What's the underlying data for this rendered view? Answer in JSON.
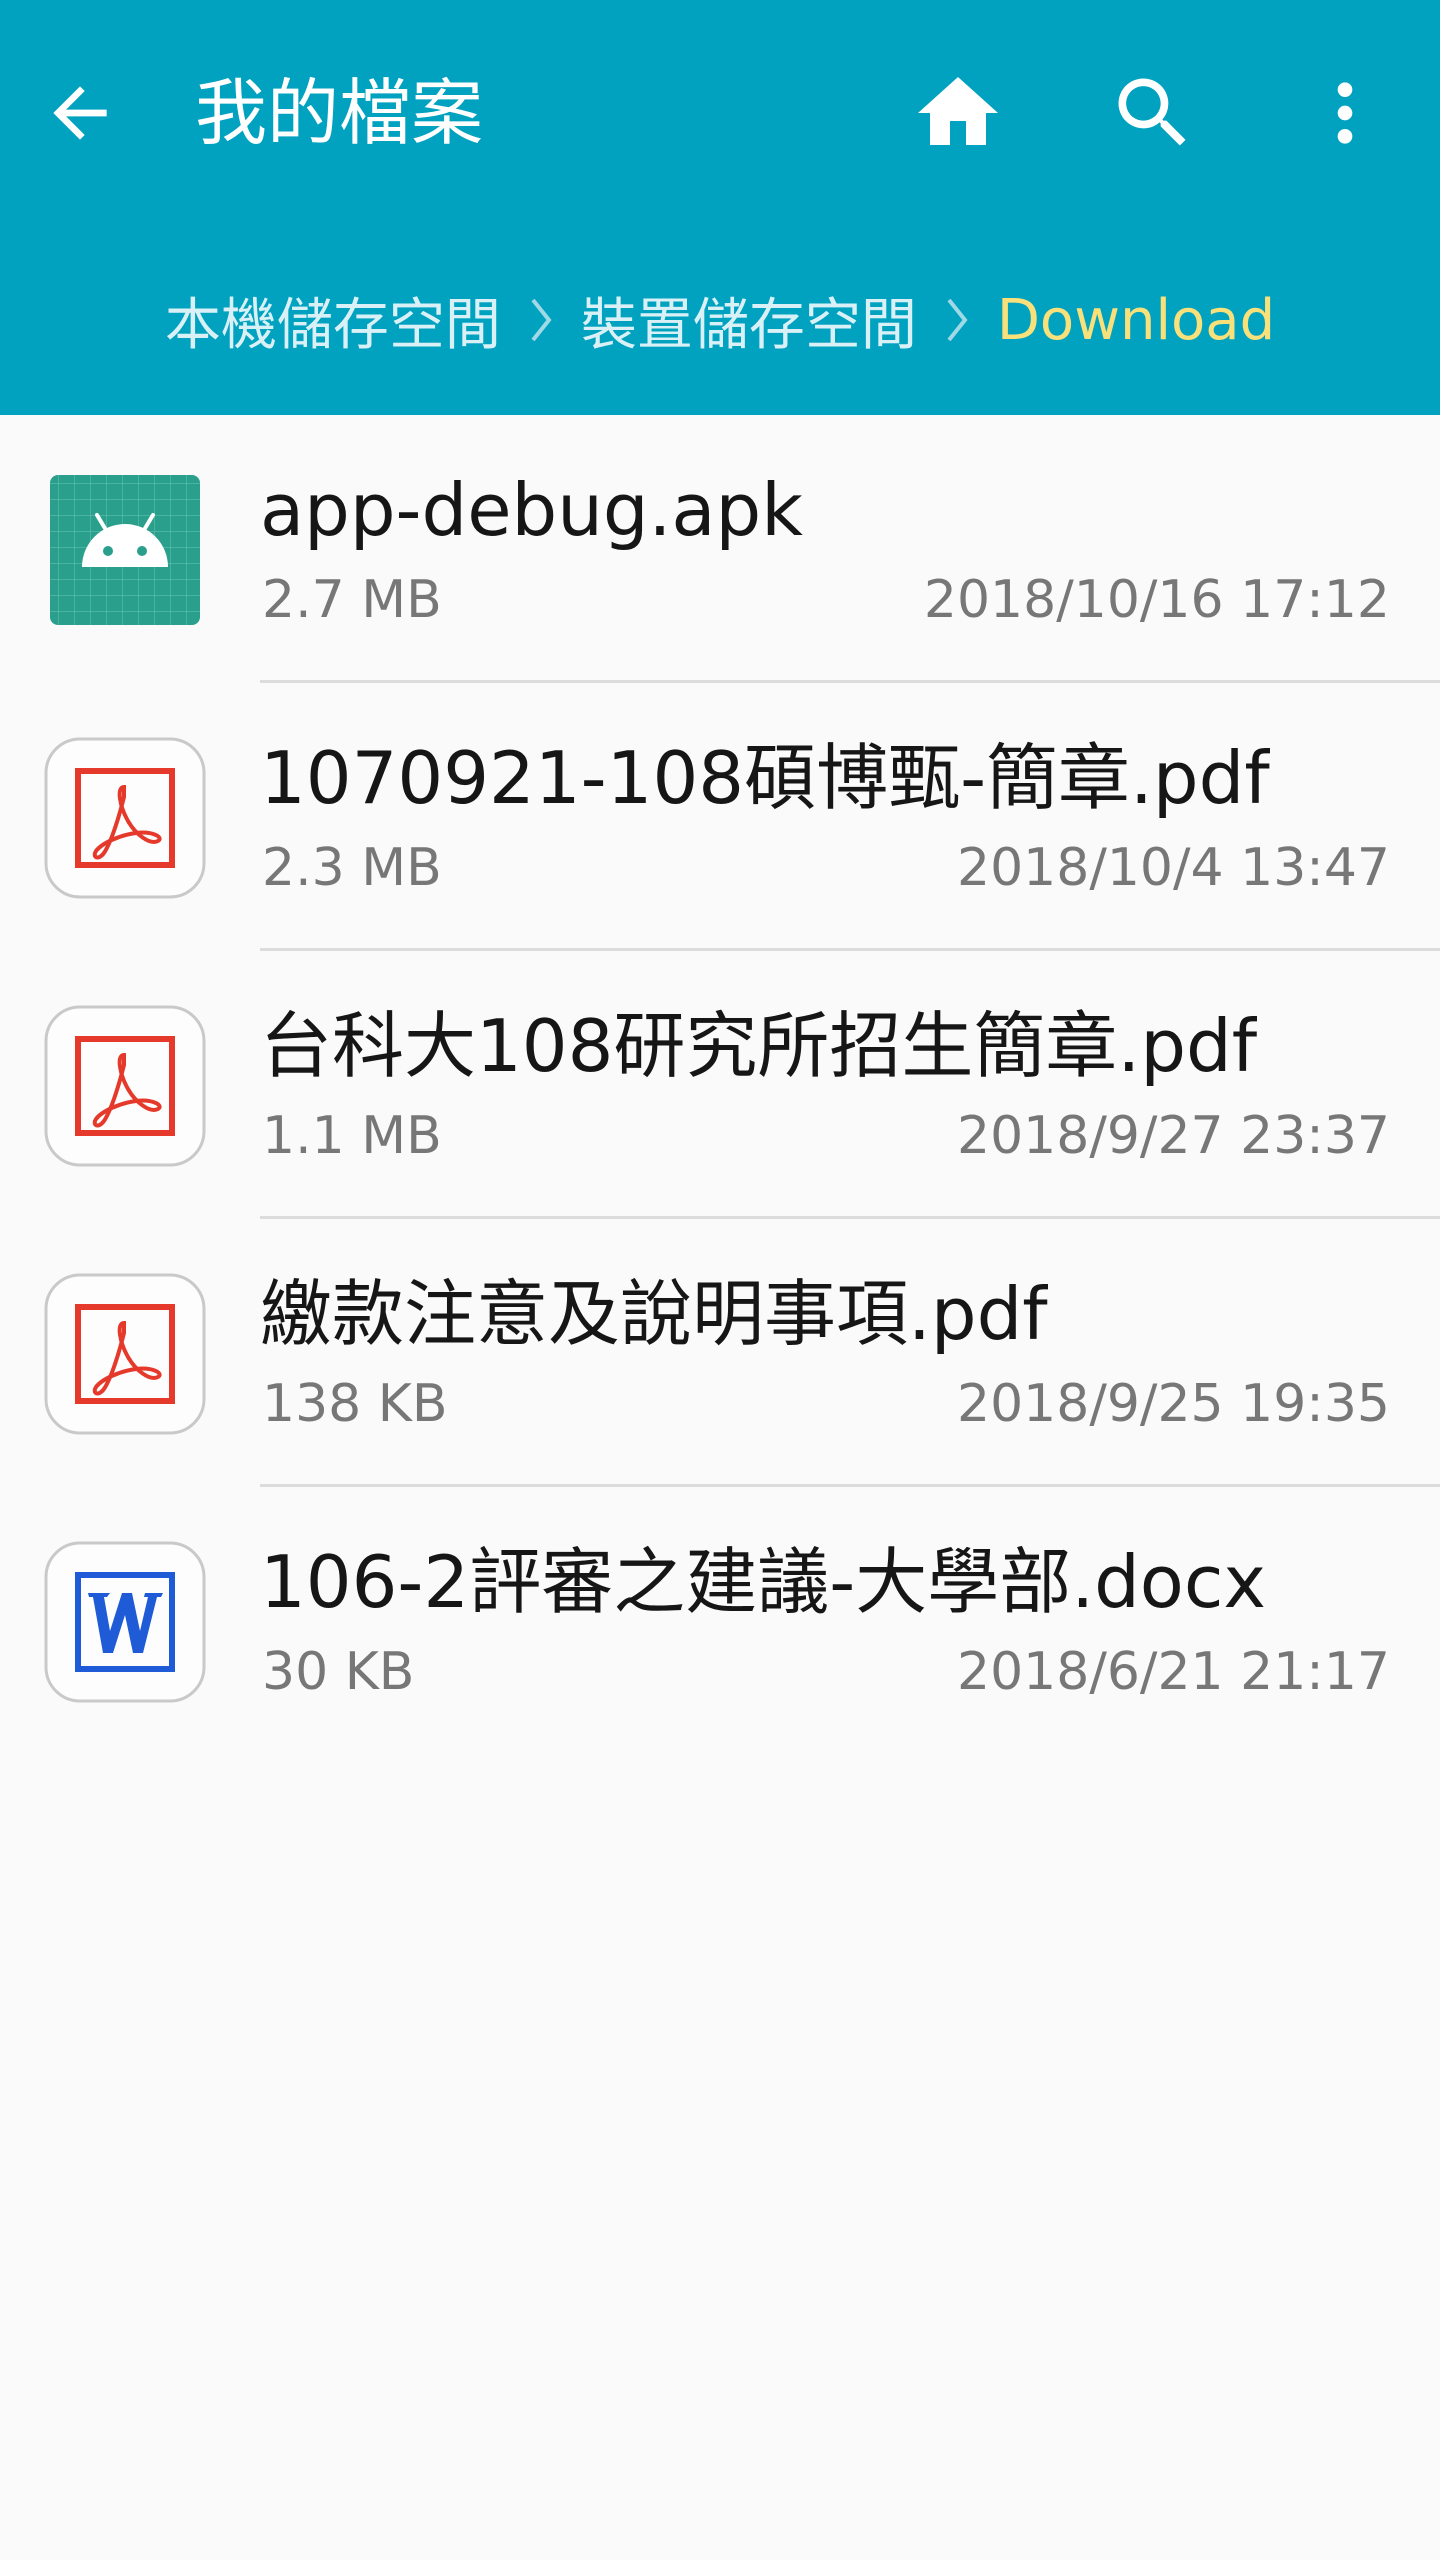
{
  "app": {
    "title": "我的檔案"
  },
  "toolbar": {
    "back_icon": "arrow-back-icon",
    "home_icon": "home-icon",
    "search_icon": "search-icon",
    "more_icon": "more-vert-icon"
  },
  "breadcrumb": [
    {
      "label": "本機儲存空間"
    },
    {
      "label": "裝置儲存空間"
    },
    {
      "label": "Download"
    }
  ],
  "colors": {
    "appbar": "#00a2c0",
    "breadcrumb_text": "#d9f1f6",
    "breadcrumb_current": "#f8e07a",
    "pdf_red": "#e53a2b",
    "word_blue": "#1f5bd6",
    "apk_green": "#2aa08c"
  },
  "files": [
    {
      "name": "app-debug.apk",
      "size": "2.7 MB",
      "date": "2018/10/16 17:12",
      "icon": "android-apk-icon"
    },
    {
      "name": "1070921-108碩博甄-簡章.pdf",
      "size": "2.3 MB",
      "date": "2018/10/4 13:47",
      "icon": "pdf-icon"
    },
    {
      "name": "台科大108研究所招生簡章.pdf",
      "size": "1.1 MB",
      "date": "2018/9/27 23:37",
      "icon": "pdf-icon"
    },
    {
      "name": "繳款注意及說明事項.pdf",
      "size": "138 KB",
      "date": "2018/9/25 19:35",
      "icon": "pdf-icon"
    },
    {
      "name": "106-2評審之建議-大學部.docx",
      "size": "30 KB",
      "date": "2018/6/21 21:17",
      "icon": "word-doc-icon"
    }
  ]
}
